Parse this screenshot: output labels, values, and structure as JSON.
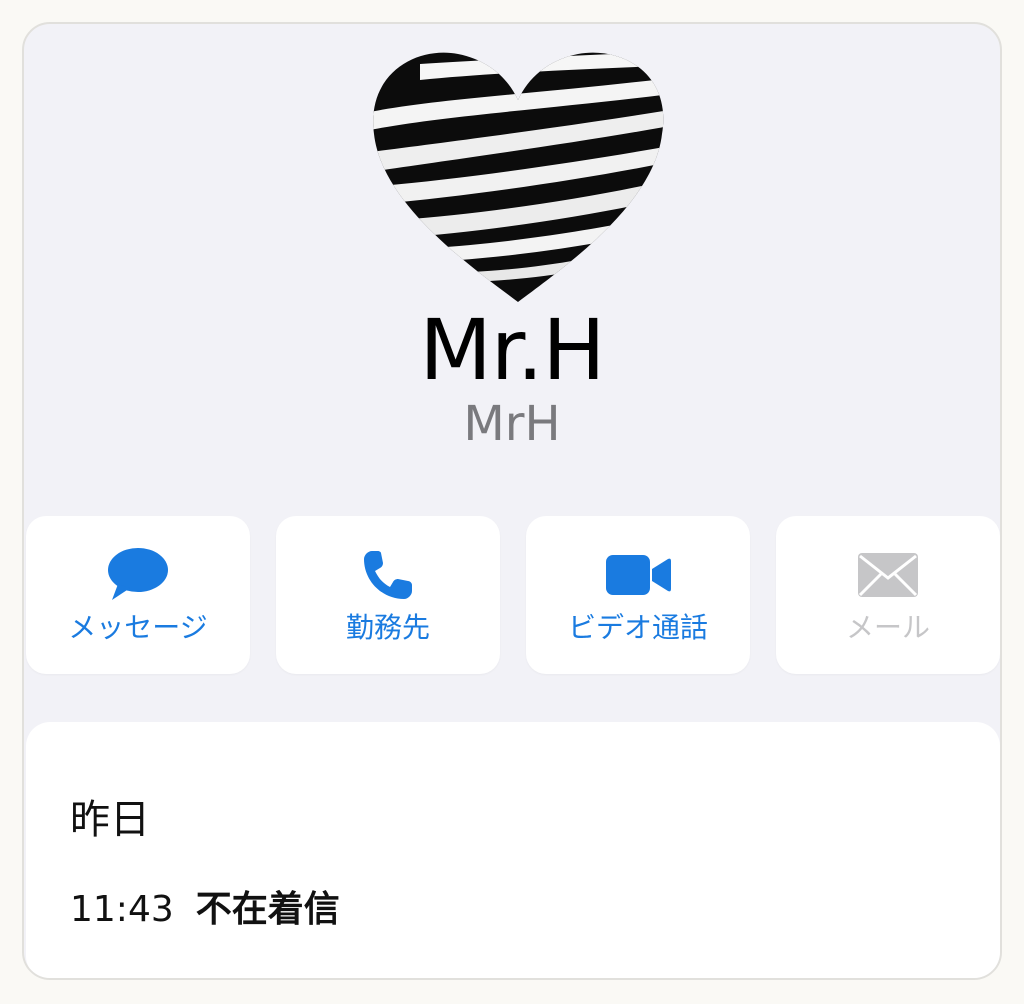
{
  "contact": {
    "name": "Mr.H",
    "subname": "MrH",
    "avatar_icon": "striped-heart-avatar"
  },
  "actions": [
    {
      "label": "メッセージ",
      "icon": "message-bubble-icon",
      "enabled": true
    },
    {
      "label": "勤務先",
      "icon": "phone-icon",
      "enabled": true
    },
    {
      "label": "ビデオ通話",
      "icon": "video-camera-icon",
      "enabled": true
    },
    {
      "label": "メール",
      "icon": "envelope-icon",
      "enabled": false
    }
  ],
  "history": {
    "date": "昨日",
    "entries": [
      {
        "time": "11:43",
        "type": "不在着信"
      }
    ]
  },
  "colors": {
    "accent": "#1a7be0",
    "disabled": "#c6c6c8",
    "background": "#f2f2f7",
    "card": "#ffffff"
  }
}
